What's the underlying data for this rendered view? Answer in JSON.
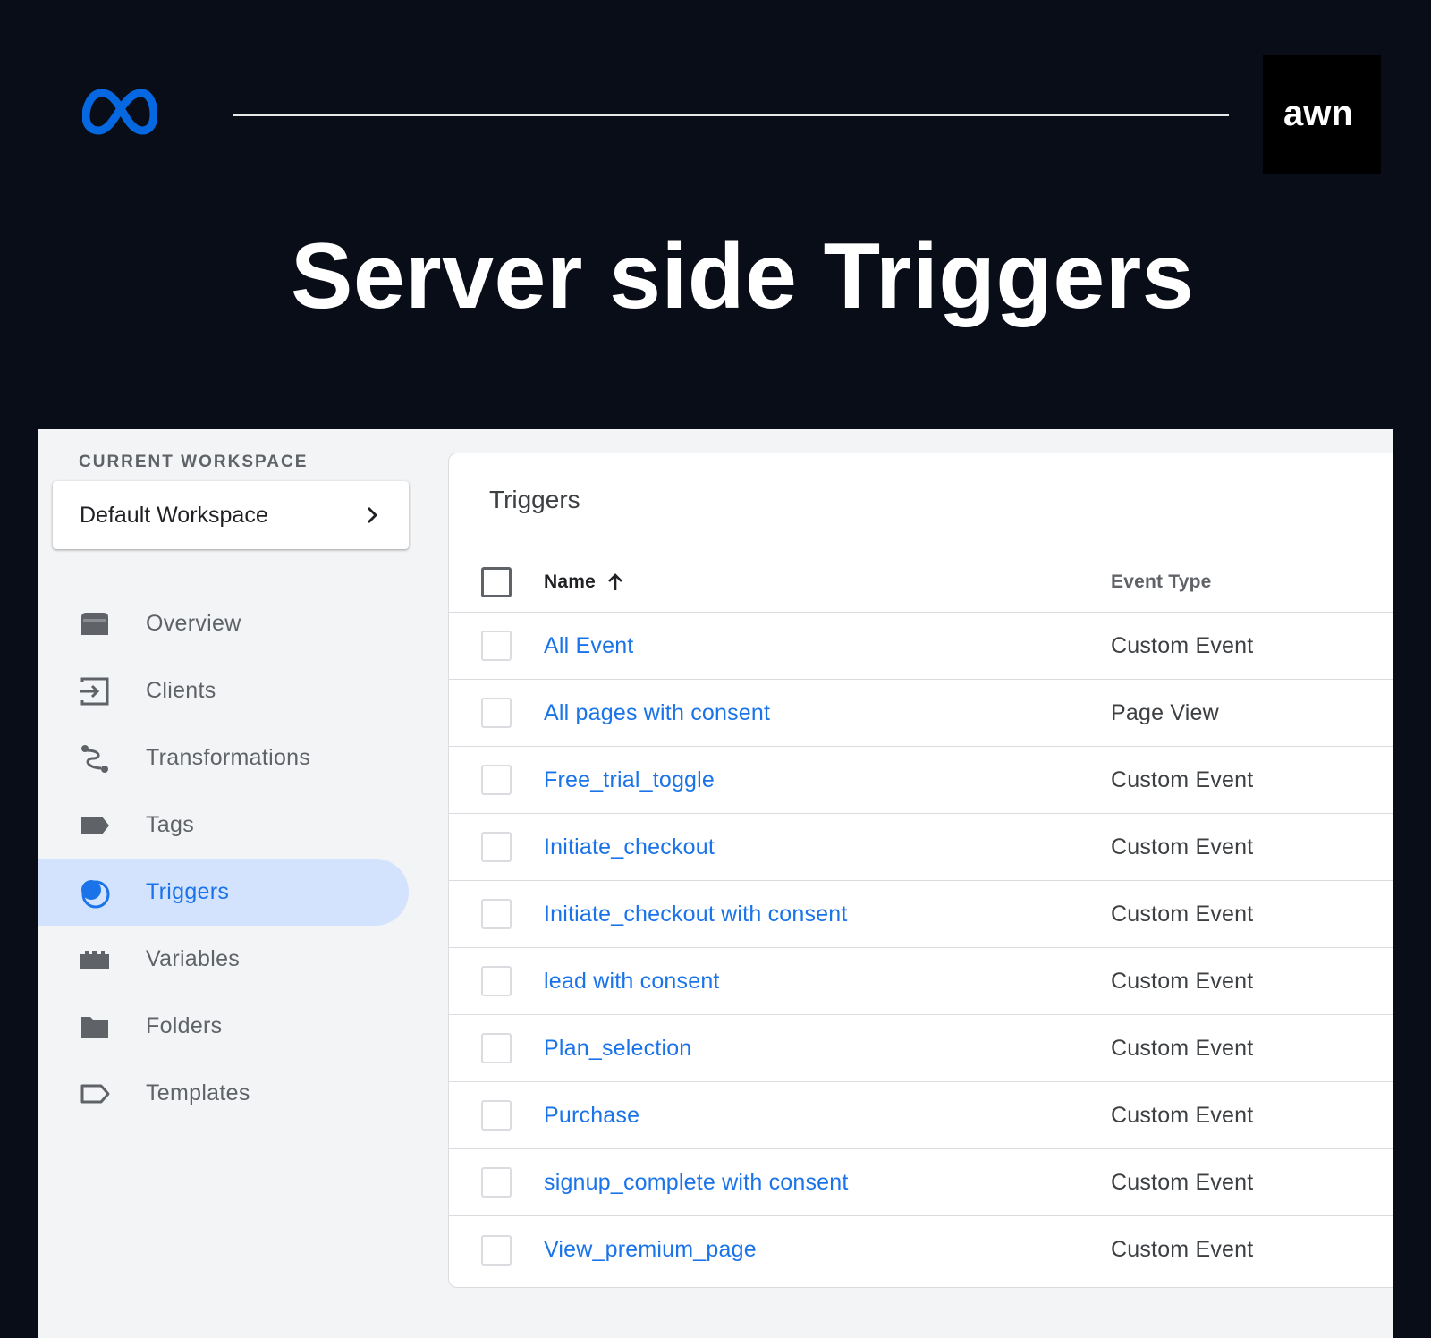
{
  "hero": {
    "title": "Server side Triggers"
  },
  "brand": {
    "meta_icon": "meta-infinity-icon",
    "partner_logo_text": "awn"
  },
  "sidebar": {
    "workspace_label": "CURRENT WORKSPACE",
    "workspace_name": "Default Workspace",
    "items": [
      {
        "label": "Overview",
        "icon": "overview-icon",
        "active": false
      },
      {
        "label": "Clients",
        "icon": "clients-icon",
        "active": false
      },
      {
        "label": "Transformations",
        "icon": "transformations-icon",
        "active": false
      },
      {
        "label": "Tags",
        "icon": "tag-icon",
        "active": false
      },
      {
        "label": "Triggers",
        "icon": "trigger-icon",
        "active": true
      },
      {
        "label": "Variables",
        "icon": "variables-icon",
        "active": false
      },
      {
        "label": "Folders",
        "icon": "folder-icon",
        "active": false
      },
      {
        "label": "Templates",
        "icon": "template-icon",
        "active": false
      }
    ]
  },
  "triggers": {
    "title": "Triggers",
    "columns": {
      "name": "Name",
      "event_type": "Event Type"
    },
    "rows": [
      {
        "name": "All Event",
        "type": "Custom Event"
      },
      {
        "name": "All pages with consent",
        "type": "Page View"
      },
      {
        "name": "Free_trial_toggle",
        "type": "Custom Event"
      },
      {
        "name": "Initiate_checkout",
        "type": "Custom Event"
      },
      {
        "name": "Initiate_checkout with consent",
        "type": "Custom Event"
      },
      {
        "name": "lead with consent",
        "type": "Custom Event"
      },
      {
        "name": "Plan_selection",
        "type": "Custom Event"
      },
      {
        "name": "Purchase",
        "type": "Custom Event"
      },
      {
        "name": "signup_complete with consent",
        "type": "Custom Event"
      },
      {
        "name": "View_premium_page",
        "type": "Custom Event"
      }
    ]
  },
  "colors": {
    "accent": "#1a73e8",
    "active_bg": "#d3e3fd",
    "page_bg": "#090d18",
    "meta_blue": "#0668e1"
  }
}
